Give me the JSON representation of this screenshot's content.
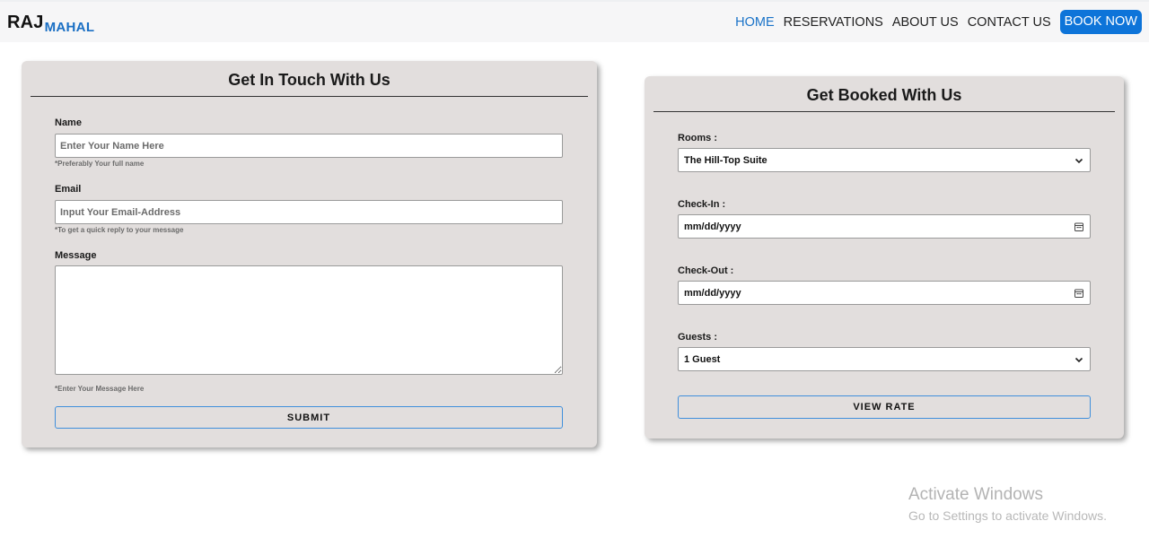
{
  "navbar": {
    "brand_main": "RAJ",
    "brand_sub": "MAHAL",
    "links": [
      {
        "label": "HOME",
        "active": true
      },
      {
        "label": "RESERVATIONS",
        "active": false
      },
      {
        "label": "ABOUT US",
        "active": false
      },
      {
        "label": "CONTACT US",
        "active": false
      }
    ],
    "cta_label": "BOOK NOW"
  },
  "contact_form": {
    "title": "Get In Touch With Us",
    "name_label": "Name",
    "name_placeholder": "Enter Your Name Here",
    "name_hint": "*Preferably Your full name",
    "email_label": "Email",
    "email_placeholder": "Input Your Email-Address",
    "email_hint": "*To get a quick reply to your message",
    "message_label": "Message",
    "message_hint": "*Enter Your Message Here",
    "submit_label": "SUBMIT"
  },
  "booking_form": {
    "title": "Get Booked With Us",
    "rooms_label": "Rooms :",
    "rooms_value": "The Hill-Top Suite",
    "checkin_label": "Check-In :",
    "checkin_value": "mm/dd/yyyy",
    "checkout_label": "Check-Out :",
    "checkout_value": "mm/dd/yyyy",
    "guests_label": "Guests :",
    "guests_value": "1 Guest",
    "view_rate_label": "VIEW RATE"
  },
  "watermark": {
    "title": "Activate Windows",
    "subtitle": "Go to Settings to activate Windows."
  },
  "colors": {
    "accent": "#0d74d9",
    "card_bg": "#e2dedd",
    "nav_bg": "#f6f6f7"
  },
  "icons": [
    "chevron-down-icon",
    "calendar-icon",
    "resize-grip-icon"
  ]
}
